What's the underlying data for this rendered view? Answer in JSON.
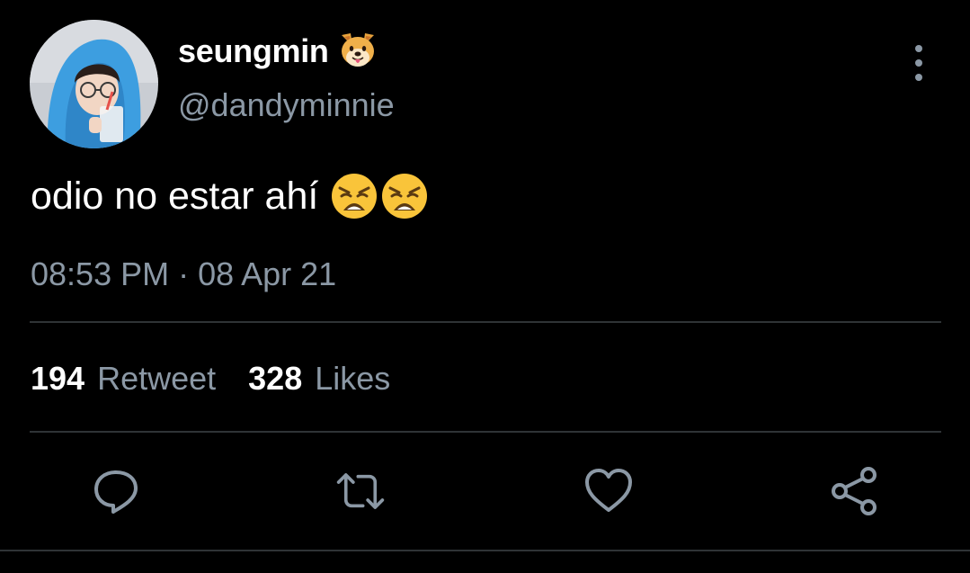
{
  "user": {
    "display_name": "seungmin",
    "name_emoji_icon": "dog-face-emoji",
    "handle": "@dandyminnie",
    "avatar_icon": "profile-photo-blue-hoodie"
  },
  "tweet": {
    "text": "odio no estar ahí",
    "emoji_icon": "weary-face-emoji",
    "emoji_count": 2,
    "timestamp": "08:53 PM · 08 Apr 21"
  },
  "stats": {
    "retweets_count": "194",
    "retweets_label": "Retweet",
    "likes_count": "328",
    "likes_label": "Likes"
  },
  "actions": [
    "reply-icon",
    "retweet-icon",
    "like-icon",
    "share-icon"
  ],
  "colors": {
    "background": "#000000",
    "primary_text": "#ffffff",
    "secondary_text": "#8b98a5",
    "divider": "#2f3336"
  }
}
